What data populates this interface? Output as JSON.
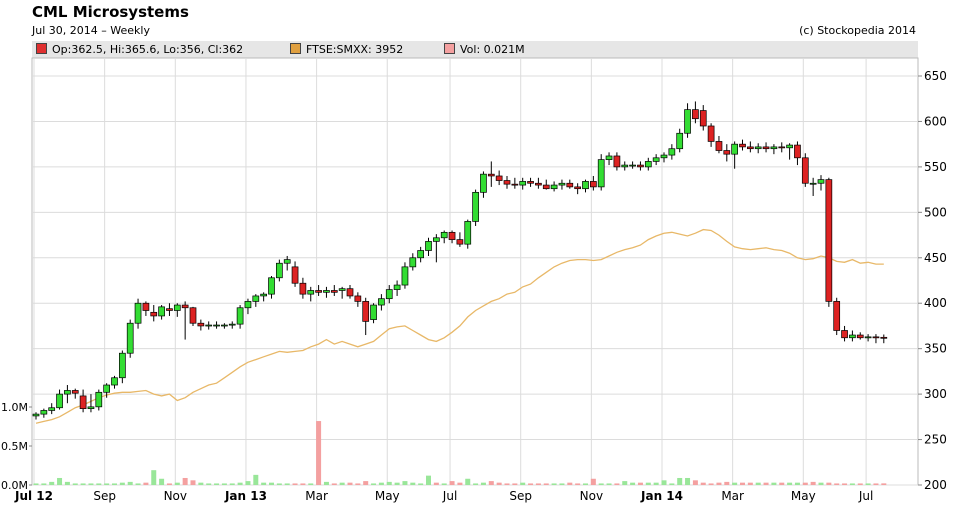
{
  "header": {
    "title": "CML Microsystems",
    "subtitle": "Jul 30, 2014 – Weekly",
    "copyright": "(c) Stockopedia 2014"
  },
  "legend": [
    {
      "label": "Op:362.5, Hi:365.6, Lo:356, Cl:362",
      "color": "#e03030"
    },
    {
      "label": "FTSE:SMXX: 3952",
      "color": "#e0a040"
    },
    {
      "label": "Vol: 0.021M",
      "color": "#f4a0a0"
    }
  ],
  "chart_data": {
    "type": "candlestick",
    "price_axis": {
      "ticks": [
        650,
        600,
        550,
        500,
        450,
        400,
        350,
        300,
        250,
        200
      ],
      "ylim": [
        200,
        670
      ],
      "position": "right"
    },
    "volume_axis": {
      "ticks": [
        "1.0M",
        "0.5M",
        "0.0M"
      ],
      "tick_values": [
        1.0,
        0.5,
        0.0
      ],
      "unit": "M",
      "position": "left"
    },
    "x_ticks": [
      {
        "label": "Jul 12",
        "bold": true,
        "week": 0
      },
      {
        "label": "Sep",
        "bold": false,
        "week": 9
      },
      {
        "label": "Nov",
        "bold": false,
        "week": 18
      },
      {
        "label": "Jan 13",
        "bold": true,
        "week": 27
      },
      {
        "label": "Mar",
        "bold": false,
        "week": 36
      },
      {
        "label": "May",
        "bold": false,
        "week": 45
      },
      {
        "label": "Jul",
        "bold": false,
        "week": 53
      },
      {
        "label": "Sep",
        "bold": false,
        "week": 62
      },
      {
        "label": "Nov",
        "bold": false,
        "week": 71
      },
      {
        "label": "Jan 14",
        "bold": true,
        "week": 80
      },
      {
        "label": "Mar",
        "bold": false,
        "week": 89
      },
      {
        "label": "May",
        "bold": false,
        "week": 98
      },
      {
        "label": "Jul",
        "bold": false,
        "week": 106
      }
    ],
    "grid": true,
    "colors": {
      "up": "#33dd33",
      "down": "#dd2222",
      "index_line": "#e8b868",
      "vol_up": "#99e699",
      "vol_down": "#f4a0a0",
      "vol_flat": "#b0b0b0"
    },
    "candles": [
      [
        276,
        280,
        272,
        278
      ],
      [
        278,
        284,
        274,
        282
      ],
      [
        282,
        290,
        278,
        285
      ],
      [
        285,
        305,
        283,
        300
      ],
      [
        300,
        310,
        290,
        304
      ],
      [
        304,
        306,
        295,
        301
      ],
      [
        298,
        305,
        280,
        284
      ],
      [
        284,
        300,
        280,
        286
      ],
      [
        286,
        305,
        282,
        302
      ],
      [
        302,
        312,
        296,
        310
      ],
      [
        310,
        320,
        306,
        318
      ],
      [
        318,
        348,
        312,
        345
      ],
      [
        345,
        382,
        340,
        378
      ],
      [
        378,
        405,
        372,
        400
      ],
      [
        400,
        402,
        386,
        392
      ],
      [
        390,
        398,
        380,
        386
      ],
      [
        386,
        398,
        382,
        396
      ],
      [
        394,
        400,
        386,
        392
      ],
      [
        392,
        400,
        385,
        398
      ],
      [
        398,
        402,
        360,
        395
      ],
      [
        395,
        396,
        375,
        378
      ],
      [
        378,
        382,
        370,
        375
      ],
      [
        375,
        380,
        371,
        376
      ],
      [
        376,
        380,
        372,
        376
      ],
      [
        376,
        378,
        372,
        376
      ],
      [
        376,
        380,
        372,
        377
      ],
      [
        377,
        398,
        372,
        395
      ],
      [
        395,
        405,
        388,
        402
      ],
      [
        402,
        410,
        396,
        408
      ],
      [
        408,
        412,
        402,
        410
      ],
      [
        410,
        430,
        405,
        428
      ],
      [
        428,
        448,
        424,
        444
      ],
      [
        444,
        452,
        436,
        448
      ],
      [
        440,
        446,
        418,
        422
      ],
      [
        422,
        428,
        405,
        410
      ],
      [
        410,
        418,
        402,
        414
      ],
      [
        414,
        420,
        408,
        412
      ],
      [
        412,
        418,
        406,
        414
      ],
      [
        414,
        420,
        408,
        412
      ],
      [
        414,
        418,
        405,
        416
      ],
      [
        416,
        420,
        405,
        408
      ],
      [
        408,
        412,
        396,
        402
      ],
      [
        402,
        406,
        365,
        380
      ],
      [
        382,
        400,
        378,
        398
      ],
      [
        398,
        410,
        392,
        405
      ],
      [
        405,
        420,
        400,
        415
      ],
      [
        415,
        425,
        408,
        420
      ],
      [
        420,
        445,
        416,
        440
      ],
      [
        440,
        455,
        436,
        450
      ],
      [
        450,
        462,
        445,
        458
      ],
      [
        458,
        472,
        452,
        468
      ],
      [
        468,
        476,
        445,
        472
      ],
      [
        472,
        480,
        466,
        478
      ],
      [
        478,
        480,
        466,
        470
      ],
      [
        470,
        478,
        462,
        465
      ],
      [
        465,
        492,
        460,
        490
      ],
      [
        490,
        525,
        485,
        522
      ],
      [
        522,
        545,
        516,
        542
      ],
      [
        542,
        556,
        528,
        540
      ],
      [
        540,
        546,
        530,
        535
      ],
      [
        535,
        540,
        526,
        531
      ],
      [
        531,
        538,
        526,
        530
      ],
      [
        530,
        538,
        525,
        534
      ],
      [
        534,
        538,
        528,
        532
      ],
      [
        532,
        538,
        526,
        530
      ],
      [
        530,
        536,
        525,
        526
      ],
      [
        526,
        534,
        523,
        530
      ],
      [
        530,
        536,
        525,
        532
      ],
      [
        532,
        536,
        526,
        528
      ],
      [
        528,
        532,
        520,
        526
      ],
      [
        526,
        536,
        522,
        534
      ],
      [
        534,
        540,
        524,
        528
      ],
      [
        528,
        564,
        524,
        558
      ],
      [
        558,
        566,
        552,
        562
      ],
      [
        562,
        566,
        546,
        550
      ],
      [
        550,
        556,
        546,
        552
      ],
      [
        552,
        556,
        548,
        552
      ],
      [
        552,
        556,
        546,
        550
      ],
      [
        550,
        560,
        546,
        556
      ],
      [
        556,
        564,
        552,
        560
      ],
      [
        560,
        566,
        555,
        563
      ],
      [
        563,
        575,
        558,
        570
      ],
      [
        570,
        592,
        566,
        587
      ],
      [
        587,
        620,
        582,
        613
      ],
      [
        613,
        622,
        598,
        603
      ],
      [
        612,
        618,
        590,
        595
      ],
      [
        595,
        598,
        572,
        578
      ],
      [
        578,
        584,
        565,
        568
      ],
      [
        568,
        575,
        556,
        564
      ],
      [
        564,
        578,
        548,
        575
      ],
      [
        575,
        580,
        568,
        572
      ],
      [
        572,
        578,
        566,
        570
      ],
      [
        570,
        576,
        565,
        572
      ],
      [
        572,
        577,
        566,
        570
      ],
      [
        570,
        575,
        564,
        572
      ],
      [
        572,
        577,
        566,
        571
      ],
      [
        571,
        576,
        558,
        574
      ],
      [
        574,
        578,
        552,
        560
      ],
      [
        560,
        565,
        528,
        532
      ],
      [
        532,
        538,
        518,
        532
      ],
      [
        532,
        541,
        524,
        536
      ],
      [
        536,
        538,
        396,
        402
      ],
      [
        402,
        406,
        365,
        370
      ],
      [
        370,
        375,
        358,
        362
      ],
      [
        362,
        370,
        358,
        365
      ],
      [
        365,
        368,
        360,
        362
      ],
      [
        362,
        366,
        358,
        363
      ],
      [
        363,
        366,
        356,
        362
      ],
      [
        362.5,
        365.6,
        356,
        362
      ]
    ],
    "index_line": [
      268,
      270,
      272,
      275,
      280,
      285,
      288,
      292,
      296,
      299,
      301,
      302,
      302,
      303,
      304,
      300,
      298,
      300,
      293,
      296,
      302,
      306,
      310,
      312,
      318,
      324,
      330,
      335,
      338,
      341,
      344,
      347,
      346,
      347,
      348,
      352,
      355,
      360,
      355,
      358,
      355,
      352,
      355,
      358,
      365,
      372,
      374,
      375,
      370,
      365,
      360,
      358,
      362,
      368,
      375,
      385,
      392,
      397,
      402,
      405,
      410,
      412,
      418,
      421,
      428,
      434,
      440,
      444,
      447,
      448,
      448,
      447,
      448,
      452,
      456,
      459,
      461,
      464,
      470,
      474,
      477,
      478,
      476,
      474,
      477,
      481,
      480,
      475,
      468,
      462,
      460,
      459,
      460,
      461,
      459,
      458,
      455,
      450,
      448,
      449,
      452,
      450,
      446,
      445,
      448,
      444,
      445,
      443,
      443
    ],
    "volume": [
      0.02,
      0.02,
      0.04,
      0.09,
      0.04,
      0.02,
      0.02,
      0.02,
      0.02,
      0.02,
      0.02,
      0.03,
      0.04,
      0.02,
      0.03,
      0.19,
      0.08,
      0.02,
      0.03,
      0.09,
      0.06,
      0.03,
      0.02,
      0.02,
      0.02,
      0.02,
      0.03,
      0.05,
      0.13,
      0.03,
      0.03,
      0.02,
      0.02,
      0.02,
      0.02,
      0.02,
      0.82,
      0.04,
      0.02,
      0.03,
      0.03,
      0.02,
      0.05,
      0.02,
      0.03,
      0.04,
      0.03,
      0.05,
      0.03,
      0.02,
      0.12,
      0.03,
      0.02,
      0.05,
      0.03,
      0.08,
      0.02,
      0.03,
      0.05,
      0.03,
      0.02,
      0.02,
      0.03,
      0.02,
      0.02,
      0.02,
      0.02,
      0.02,
      0.03,
      0.02,
      0.02,
      0.08,
      0.02,
      0.02,
      0.02,
      0.05,
      0.03,
      0.03,
      0.03,
      0.03,
      0.06,
      0.02,
      0.09,
      0.09,
      0.06,
      0.03,
      0.02,
      0.03,
      0.04,
      0.03,
      0.03,
      0.03,
      0.03,
      0.03,
      0.03,
      0.03,
      0.03,
      0.03,
      0.03,
      0.04,
      0.03,
      0.03,
      0.02,
      0.02,
      0.02,
      0.02,
      0.02,
      0.02,
      0.021
    ],
    "volume_direction": [
      1,
      1,
      1,
      1,
      1,
      1,
      1,
      1,
      1,
      1,
      1,
      1,
      1,
      1,
      -1,
      1,
      1,
      -1,
      1,
      -1,
      -1,
      1,
      1,
      1,
      1,
      1,
      1,
      1,
      1,
      1,
      1,
      1,
      1,
      -1,
      -1,
      1,
      -1,
      1,
      -1,
      1,
      -1,
      -1,
      -1,
      1,
      1,
      1,
      1,
      1,
      1,
      1,
      1,
      -1,
      1,
      -1,
      -1,
      1,
      1,
      1,
      -1,
      -1,
      -1,
      -1,
      1,
      -1,
      -1,
      -1,
      1,
      1,
      -1,
      -1,
      1,
      -1,
      1,
      1,
      -1,
      1,
      1,
      -1,
      1,
      1,
      1,
      1,
      1,
      1,
      -1,
      -1,
      -1,
      -1,
      -1,
      1,
      -1,
      -1,
      1,
      -1,
      1,
      -1,
      1,
      1,
      -1,
      -1,
      1,
      -1,
      -1,
      -1,
      1,
      -1,
      1,
      -1,
      -1
    ]
  }
}
